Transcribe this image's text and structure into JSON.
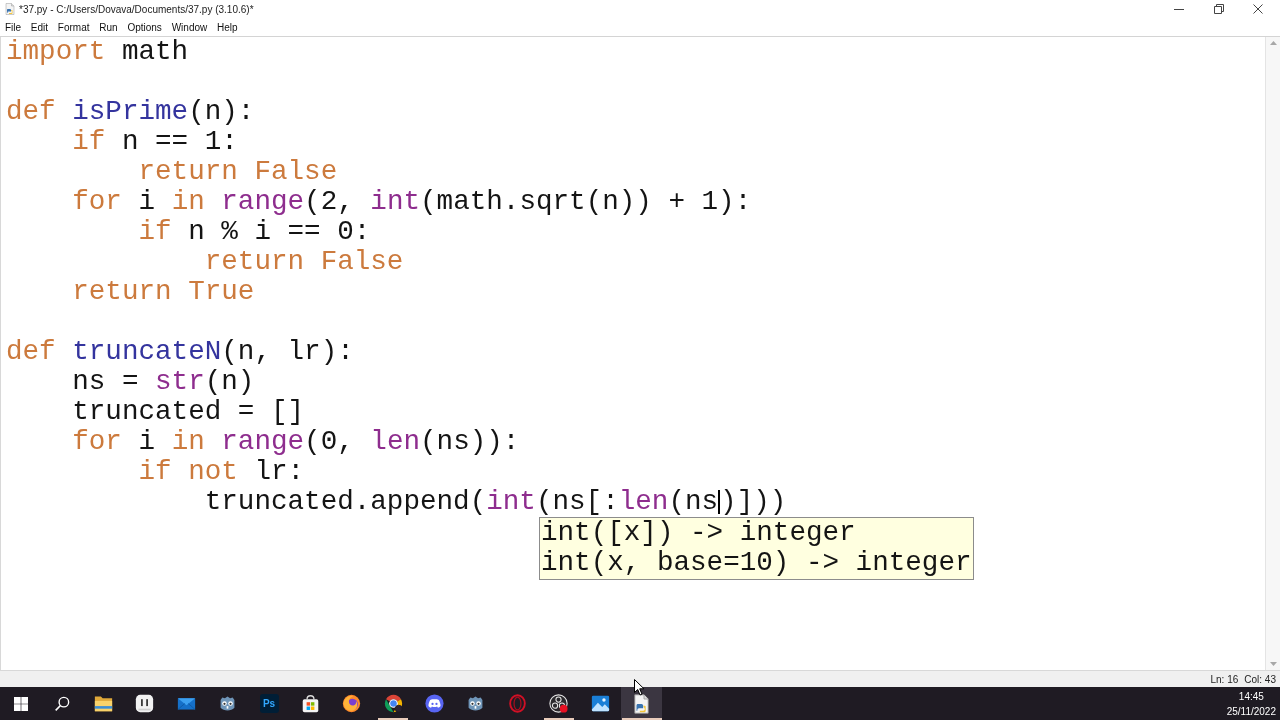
{
  "window": {
    "title": "*37.py - C:/Users/Dovava/Documents/37.py (3.10.6)*"
  },
  "menu": [
    "File",
    "Edit",
    "Format",
    "Run",
    "Options",
    "Window",
    "Help"
  ],
  "editor": {
    "lines": [
      {
        "kind": "code",
        "tokens": [
          {
            "text": "import",
            "kind": "keyword"
          },
          {
            "text": " math",
            "kind": "plain"
          }
        ]
      },
      {
        "kind": "blank"
      },
      {
        "kind": "code",
        "tokens": [
          {
            "text": "def ",
            "kind": "keyword"
          },
          {
            "text": "isPrime",
            "kind": "definition"
          },
          {
            "text": "(n):",
            "kind": "plain"
          }
        ]
      },
      {
        "kind": "code",
        "tokens": [
          {
            "text": "    if",
            "kind": "keyword"
          },
          {
            "text": " n == 1:",
            "kind": "plain"
          }
        ]
      },
      {
        "kind": "code",
        "tokens": [
          {
            "text": "        return False",
            "kind": "keyword"
          }
        ]
      },
      {
        "kind": "code",
        "tokens": [
          {
            "text": "    for",
            "kind": "keyword"
          },
          {
            "text": " i ",
            "kind": "plain"
          },
          {
            "text": "in ",
            "kind": "keyword"
          },
          {
            "text": "range",
            "kind": "builtin"
          },
          {
            "text": "(2, ",
            "kind": "plain"
          },
          {
            "text": "int",
            "kind": "builtin"
          },
          {
            "text": "(math.sqrt(n)) + 1):",
            "kind": "plain"
          }
        ]
      },
      {
        "kind": "code",
        "tokens": [
          {
            "text": "        if",
            "kind": "keyword"
          },
          {
            "text": " n % i == 0:",
            "kind": "plain"
          }
        ]
      },
      {
        "kind": "code",
        "tokens": [
          {
            "text": "            return False",
            "kind": "keyword"
          }
        ]
      },
      {
        "kind": "code",
        "tokens": [
          {
            "text": "    return True",
            "kind": "keyword"
          }
        ]
      },
      {
        "kind": "blank"
      },
      {
        "kind": "code",
        "tokens": [
          {
            "text": "def ",
            "kind": "keyword"
          },
          {
            "text": "truncateN",
            "kind": "definition"
          },
          {
            "text": "(n, lr):",
            "kind": "plain"
          }
        ]
      },
      {
        "kind": "code",
        "tokens": [
          {
            "text": "    ns = ",
            "kind": "plain"
          },
          {
            "text": "str",
            "kind": "builtin"
          },
          {
            "text": "(n)",
            "kind": "plain"
          }
        ]
      },
      {
        "kind": "code",
        "tokens": [
          {
            "text": "    truncated = []",
            "kind": "plain"
          }
        ]
      },
      {
        "kind": "code",
        "tokens": [
          {
            "text": "    for",
            "kind": "keyword"
          },
          {
            "text": " i ",
            "kind": "plain"
          },
          {
            "text": "in ",
            "kind": "keyword"
          },
          {
            "text": "range",
            "kind": "builtin"
          },
          {
            "text": "(0, ",
            "kind": "plain"
          },
          {
            "text": "len",
            "kind": "builtin"
          },
          {
            "text": "(ns)):",
            "kind": "plain"
          }
        ]
      },
      {
        "kind": "code",
        "tokens": [
          {
            "text": "        if not",
            "kind": "keyword"
          },
          {
            "text": " lr:",
            "kind": "plain"
          }
        ]
      },
      {
        "kind": "code",
        "tokens": [
          {
            "text": "            truncated.append(",
            "kind": "plain"
          },
          {
            "text": "int",
            "kind": "builtin"
          },
          {
            "text": "(ns[:",
            "kind": "plain"
          },
          {
            "text": "len",
            "kind": "builtin"
          },
          {
            "text": "(ns",
            "kind": "plain"
          },
          {
            "kind": "caret"
          },
          {
            "text": ")]))",
            "kind": "plain"
          }
        ]
      }
    ]
  },
  "calltip": {
    "lines": [
      "int([x]) -> integer",
      "int(x, base=10) -> integer"
    ]
  },
  "status_bar": {
    "line": "Ln: 16",
    "column": "Col: 43"
  },
  "taskbar": {
    "items": [
      {
        "kind": "start",
        "running": false,
        "selected": false
      },
      {
        "kind": "search",
        "running": false,
        "selected": false
      },
      {
        "kind": "folder",
        "running": false,
        "selected": false
      },
      {
        "kind": "tile",
        "running": false,
        "selected": false
      },
      {
        "kind": "envelope",
        "running": false,
        "selected": false
      },
      {
        "kind": "robot",
        "running": false,
        "selected": false
      },
      {
        "kind": "lettered",
        "label": "Ps",
        "running": false,
        "selected": false
      },
      {
        "kind": "bag",
        "running": false,
        "selected": false
      },
      {
        "kind": "foxglobe",
        "running": false,
        "selected": false
      },
      {
        "kind": "tricolor",
        "running": true,
        "selected": false
      },
      {
        "kind": "chatface",
        "running": false,
        "selected": false
      },
      {
        "kind": "robot",
        "running": false,
        "selected": false
      },
      {
        "kind": "ring",
        "running": false,
        "selected": false
      },
      {
        "kind": "recorder",
        "running": true,
        "selected": false
      },
      {
        "kind": "landscape",
        "running": false,
        "selected": false
      },
      {
        "kind": "document",
        "running": true,
        "selected": true
      }
    ],
    "clock": {
      "time": "14:45",
      "date": "25/11/2022"
    }
  }
}
